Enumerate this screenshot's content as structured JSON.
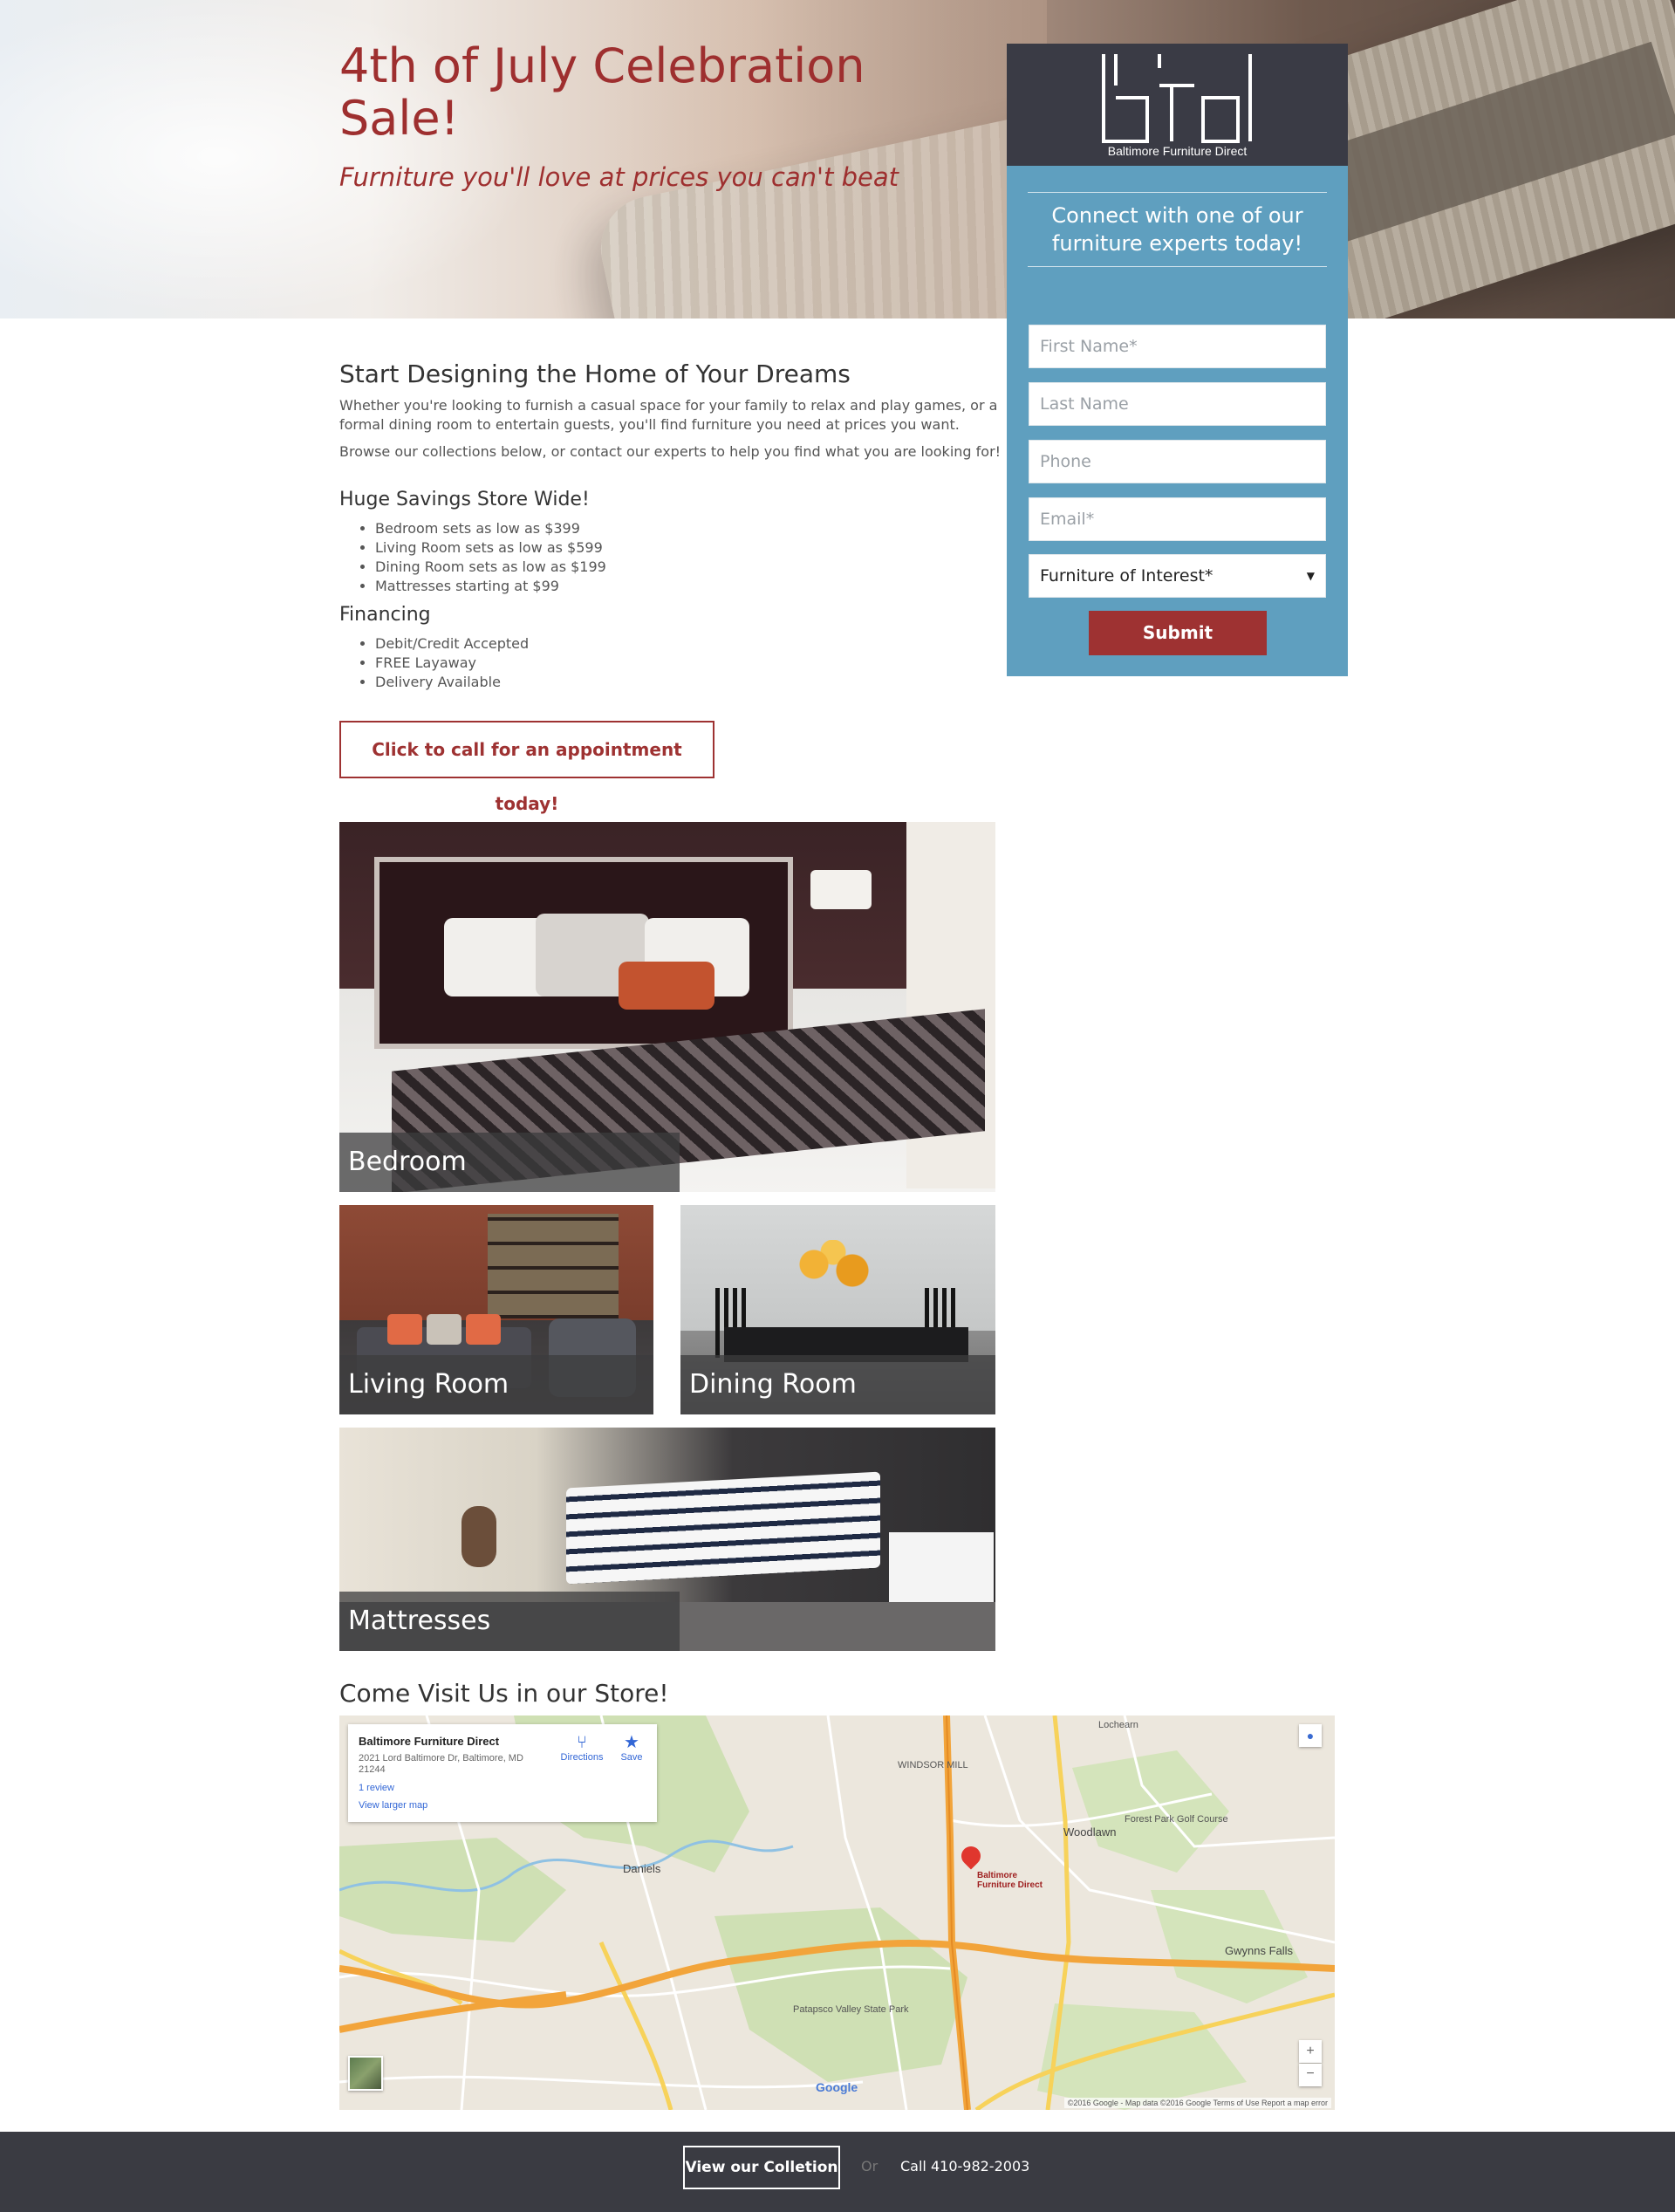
{
  "hero": {
    "title": "4th of July Celebration Sale!",
    "subtitle": "Furniture you'll love at prices you can't beat"
  },
  "sidebar": {
    "logo_caption": "Baltimore Furniture Direct",
    "connect_text": "Connect with one of our furniture experts today!",
    "fields": {
      "first_name_placeholder": "First Name*",
      "last_name_placeholder": "Last Name",
      "phone_placeholder": "Phone",
      "email_placeholder": "Email*",
      "interest_selected": "Furniture of Interest*"
    },
    "submit_label": "Submit"
  },
  "main": {
    "heading": "Start Designing the Home of Your Dreams",
    "intro": "Whether you're looking to furnish a casual space for your family to relax and play games, or a formal dining room to entertain guests, you'll find furniture you need at prices you want.",
    "browse": "Browse our collections below, or contact our experts to help you find what you are looking for!",
    "savings_heading": "Huge Savings Store Wide!",
    "savings_items": [
      "Bedroom sets as low as $399",
      "Living Room sets as low as $599",
      "Dining Room sets as low as $199",
      "Mattresses starting at $99"
    ],
    "financing_heading": "Financing",
    "financing_items": [
      "Debit/Credit Accepted",
      "FREE Layaway",
      "Delivery Available"
    ],
    "cta_label": "Click to call for an appointment today!"
  },
  "collections": {
    "bedroom": "Bedroom",
    "living_room": "Living Room",
    "dining_room": "Dining Room",
    "mattresses": "Mattresses"
  },
  "visit": {
    "heading": "Come Visit Us in our Store!",
    "map": {
      "place_name": "Baltimore Furniture Direct",
      "address": "2021 Lord Baltimore Dr, Baltimore, MD 21244",
      "reviews": "1 review",
      "larger_map": "View larger map",
      "directions": "Directions",
      "save": "Save",
      "pin_label_line1": "Baltimore",
      "pin_label_line2": "Furniture Direct",
      "logo": "Google",
      "credits": "©2016 Google - Map data ©2016 Google   Terms of Use   Report a map error",
      "zoom_in": "+",
      "zoom_out": "−",
      "labels": {
        "woodlawn": "Woodlawn",
        "daniels": "Daniels",
        "gwynns_falls": "Gwynns Falls",
        "patapsco": "Patapsco Valley State Park",
        "windsor_mill": "WINDSOR MILL",
        "forest_park": "Forest Park Golf Course",
        "lochearn": "Lochearn"
      }
    }
  },
  "footer": {
    "view_label": "View our Colletion",
    "or_label": "Or",
    "call_label": "Call 410-982-2003"
  }
}
